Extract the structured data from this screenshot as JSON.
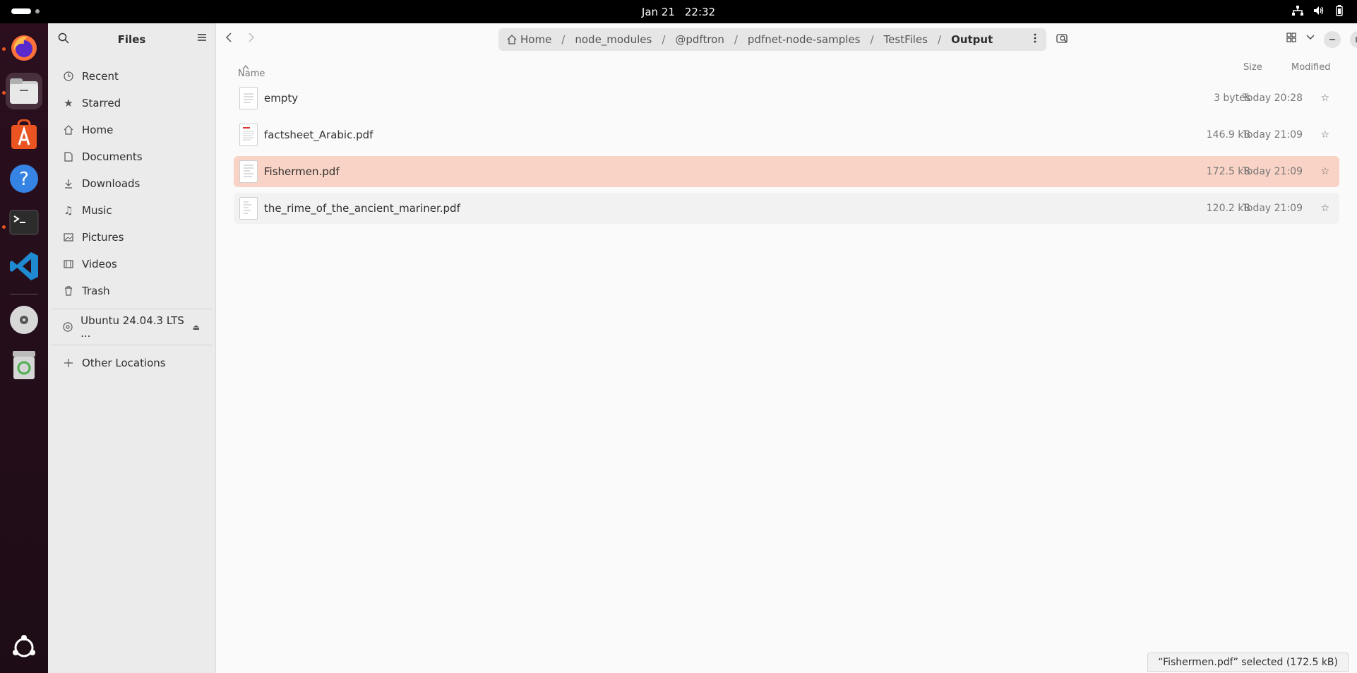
{
  "topbar": {
    "date": "Jan 21",
    "time": "22:32"
  },
  "dock": {
    "apps": [
      "firefox-icon",
      "files-icon",
      "app-center-icon",
      "help-icon",
      "terminal-icon",
      "vscode-icon",
      "disc-icon",
      "trash-icon",
      "show-apps-icon"
    ]
  },
  "sidebar": {
    "title": "Files",
    "items": [
      {
        "label": "Recent",
        "icon": "clock-icon"
      },
      {
        "label": "Starred",
        "icon": "star-icon"
      },
      {
        "label": "Home",
        "icon": "home-icon"
      },
      {
        "label": "Documents",
        "icon": "document-icon"
      },
      {
        "label": "Downloads",
        "icon": "download-icon"
      },
      {
        "label": "Music",
        "icon": "music-icon"
      },
      {
        "label": "Pictures",
        "icon": "picture-icon"
      },
      {
        "label": "Videos",
        "icon": "video-icon"
      },
      {
        "label": "Trash",
        "icon": "trash-icon"
      }
    ],
    "device": "Ubuntu 24.04.3 LTS ...",
    "other_locations": "Other Locations"
  },
  "path": {
    "crumbs": [
      "Home",
      "node_modules",
      "@pdftron",
      "pdfnet-node-samples",
      "TestFiles",
      "Output"
    ]
  },
  "columns": {
    "name": "Name",
    "size": "Size",
    "modified": "Modified"
  },
  "files": [
    {
      "name": "empty",
      "size": "3 bytes",
      "modified": "Today 20:28"
    },
    {
      "name": "factsheet_Arabic.pdf",
      "size": "146.9 kB",
      "modified": "Today 21:09"
    },
    {
      "name": "Fishermen.pdf",
      "size": "172.5 kB",
      "modified": "Today 21:09"
    },
    {
      "name": "the_rime_of_the_ancient_mariner.pdf",
      "size": "120.2 kB",
      "modified": "Today 21:09"
    }
  ],
  "status": {
    "text": "“Fishermen.pdf” selected  (172.5 kB)"
  },
  "colors": {
    "selected_row": "#f9d3c5",
    "accent": "#e95420"
  }
}
